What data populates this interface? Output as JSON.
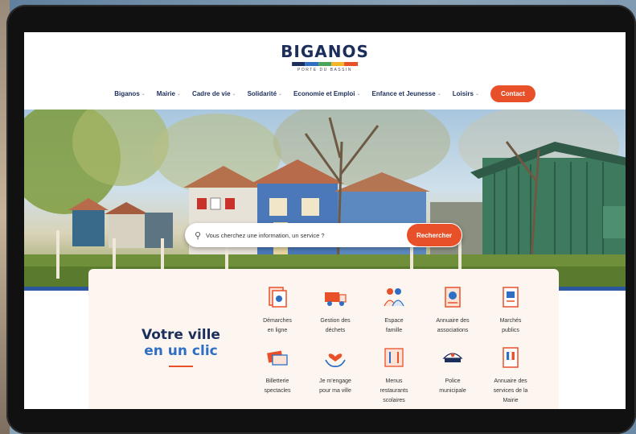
{
  "brand": {
    "name": "BIGANOS",
    "tagline": "PORTE DU BASSIN",
    "bar_colors": [
      "#1c2e5c",
      "#2f6fc3",
      "#4aa55a",
      "#f1b62a",
      "#e8502a"
    ]
  },
  "nav": {
    "items": [
      {
        "label": "Biganos"
      },
      {
        "label": "Mairie"
      },
      {
        "label": "Cadre de vie"
      },
      {
        "label": "Solidarité"
      },
      {
        "label": "Economie et Emploi"
      },
      {
        "label": "Enfance et Jeunesse"
      },
      {
        "label": "Loisirs"
      }
    ],
    "contact_label": "Contact"
  },
  "search": {
    "placeholder": "Vous cherchez une information, un service ?",
    "button_label": "Rechercher"
  },
  "promo": {
    "title_line1": "Votre ville",
    "title_line2": "en un clic"
  },
  "services": [
    {
      "line1": "Démarches",
      "line2": "en ligne",
      "line3": "",
      "icon": "documents-icon"
    },
    {
      "line1": "Gestion des",
      "line2": "déchets",
      "line3": "",
      "icon": "garbage-truck-icon"
    },
    {
      "line1": "Espace",
      "line2": "famille",
      "line3": "",
      "icon": "family-icon"
    },
    {
      "line1": "Annuaire des",
      "line2": "associations",
      "line3": "",
      "icon": "directory-book-icon"
    },
    {
      "line1": "Marchés",
      "line2": "publics",
      "line3": "",
      "icon": "public-tender-icon"
    },
    {
      "line1": "Billetterie",
      "line2": "spectacles",
      "line3": "",
      "icon": "tickets-icon"
    },
    {
      "line1": "Je m'engage",
      "line2": "pour ma ville",
      "line3": "",
      "icon": "heart-hands-icon"
    },
    {
      "line1": "Menus",
      "line2": "restaurants",
      "line3": "scolaires",
      "icon": "menu-cutlery-icon"
    },
    {
      "line1": "Police",
      "line2": "municipale",
      "line3": "",
      "icon": "police-cap-icon"
    },
    {
      "line1": "Annuaire des",
      "line2": "services de la",
      "line3": "Mairie",
      "icon": "city-hall-directory-icon"
    }
  ],
  "colors": {
    "accent": "#e8502a",
    "navy": "#1c2e5c",
    "blue": "#2f6fc3"
  }
}
